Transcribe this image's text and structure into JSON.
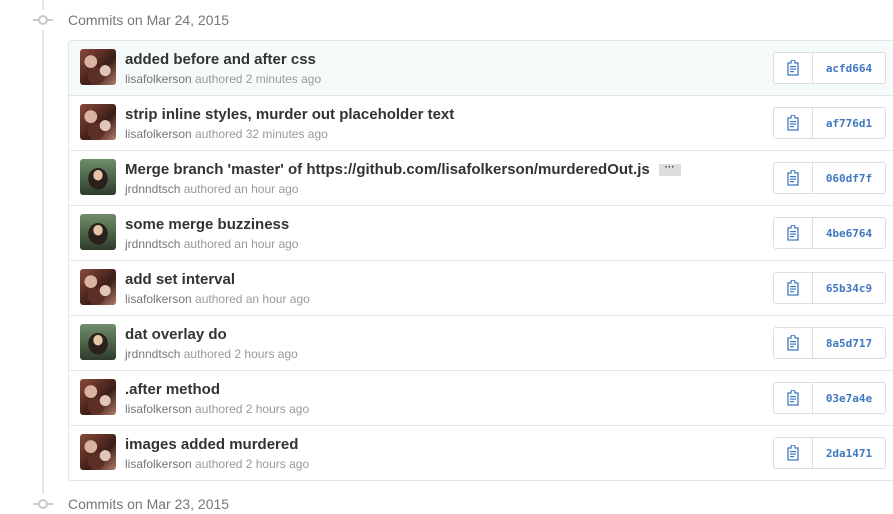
{
  "groups": [
    {
      "title": "Commits on Mar 24, 2015"
    },
    {
      "title": "Commits on Mar 23, 2015"
    }
  ],
  "colors": {
    "sha_link": "#4078c0",
    "highlight_row": "#f4fbfa",
    "title_text": "#333333",
    "meta_text": "#767676"
  },
  "icons": {
    "copy": "clipboard-icon",
    "more": "ellipsis-icon",
    "timeline": "commit-dot-icon"
  },
  "commits": [
    {
      "title": "added before and after css",
      "author": "lisafolkerson",
      "time": "authored 2 minutes ago",
      "sha": "acfd664"
    },
    {
      "title": "strip inline styles, murder out placeholder text",
      "author": "lisafolkerson",
      "time": "authored 32 minutes ago",
      "sha": "af776d1"
    },
    {
      "title": "Merge branch 'master' of https://github.com/lisafolkerson/murderedOut.js",
      "more": "···",
      "author": "jrdnndtsch",
      "time": "authored an hour ago",
      "sha": "060df7f"
    },
    {
      "title": "some merge buzziness",
      "author": "jrdnndtsch",
      "time": "authored an hour ago",
      "sha": "4be6764"
    },
    {
      "title": "add set interval",
      "author": "lisafolkerson",
      "time": "authored an hour ago",
      "sha": "65b34c9"
    },
    {
      "title": "dat overlay do",
      "author": "jrdnndtsch",
      "time": "authored 2 hours ago",
      "sha": "8a5d717"
    },
    {
      "title": ".after method",
      "author": "lisafolkerson",
      "time": "authored 2 hours ago",
      "sha": "03e7a4e"
    },
    {
      "title": "images added murdered",
      "author": "lisafolkerson",
      "time": "authored 2 hours ago",
      "sha": "2da1471"
    }
  ]
}
